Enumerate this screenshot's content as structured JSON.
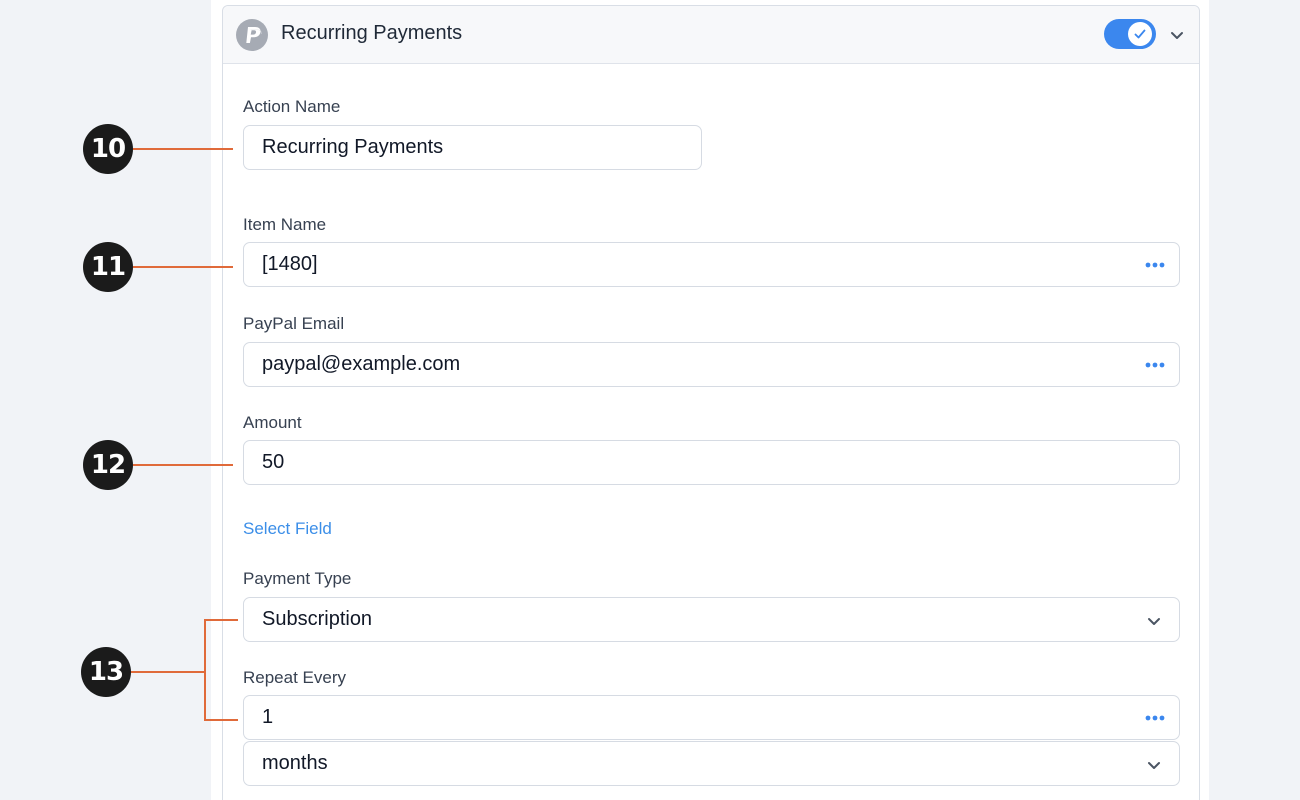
{
  "panel": {
    "title": "Recurring Payments",
    "enabled": true,
    "icons": {
      "brand": "paypal-icon",
      "toggle": "check-icon",
      "collapse": "chevron-down-icon"
    }
  },
  "fields": {
    "action_name": {
      "label": "Action Name",
      "value": "Recurring Payments"
    },
    "item_name": {
      "label": "Item Name",
      "value": "[1480]"
    },
    "paypal_email": {
      "label": "PayPal Email",
      "value": "paypal@example.com"
    },
    "amount": {
      "label": "Amount",
      "value": "50"
    },
    "select_field_link": "Select Field",
    "payment_type": {
      "label": "Payment Type",
      "value": "Subscription"
    },
    "repeat_every": {
      "label": "Repeat Every",
      "value": "1",
      "unit": "months"
    }
  },
  "callouts": [
    "10",
    "11",
    "12",
    "13"
  ],
  "colors": {
    "accent": "#3b87ee",
    "link": "#3b8ee8",
    "callout_line": "#e06a3a",
    "callout_badge": "#1b1b1b"
  }
}
